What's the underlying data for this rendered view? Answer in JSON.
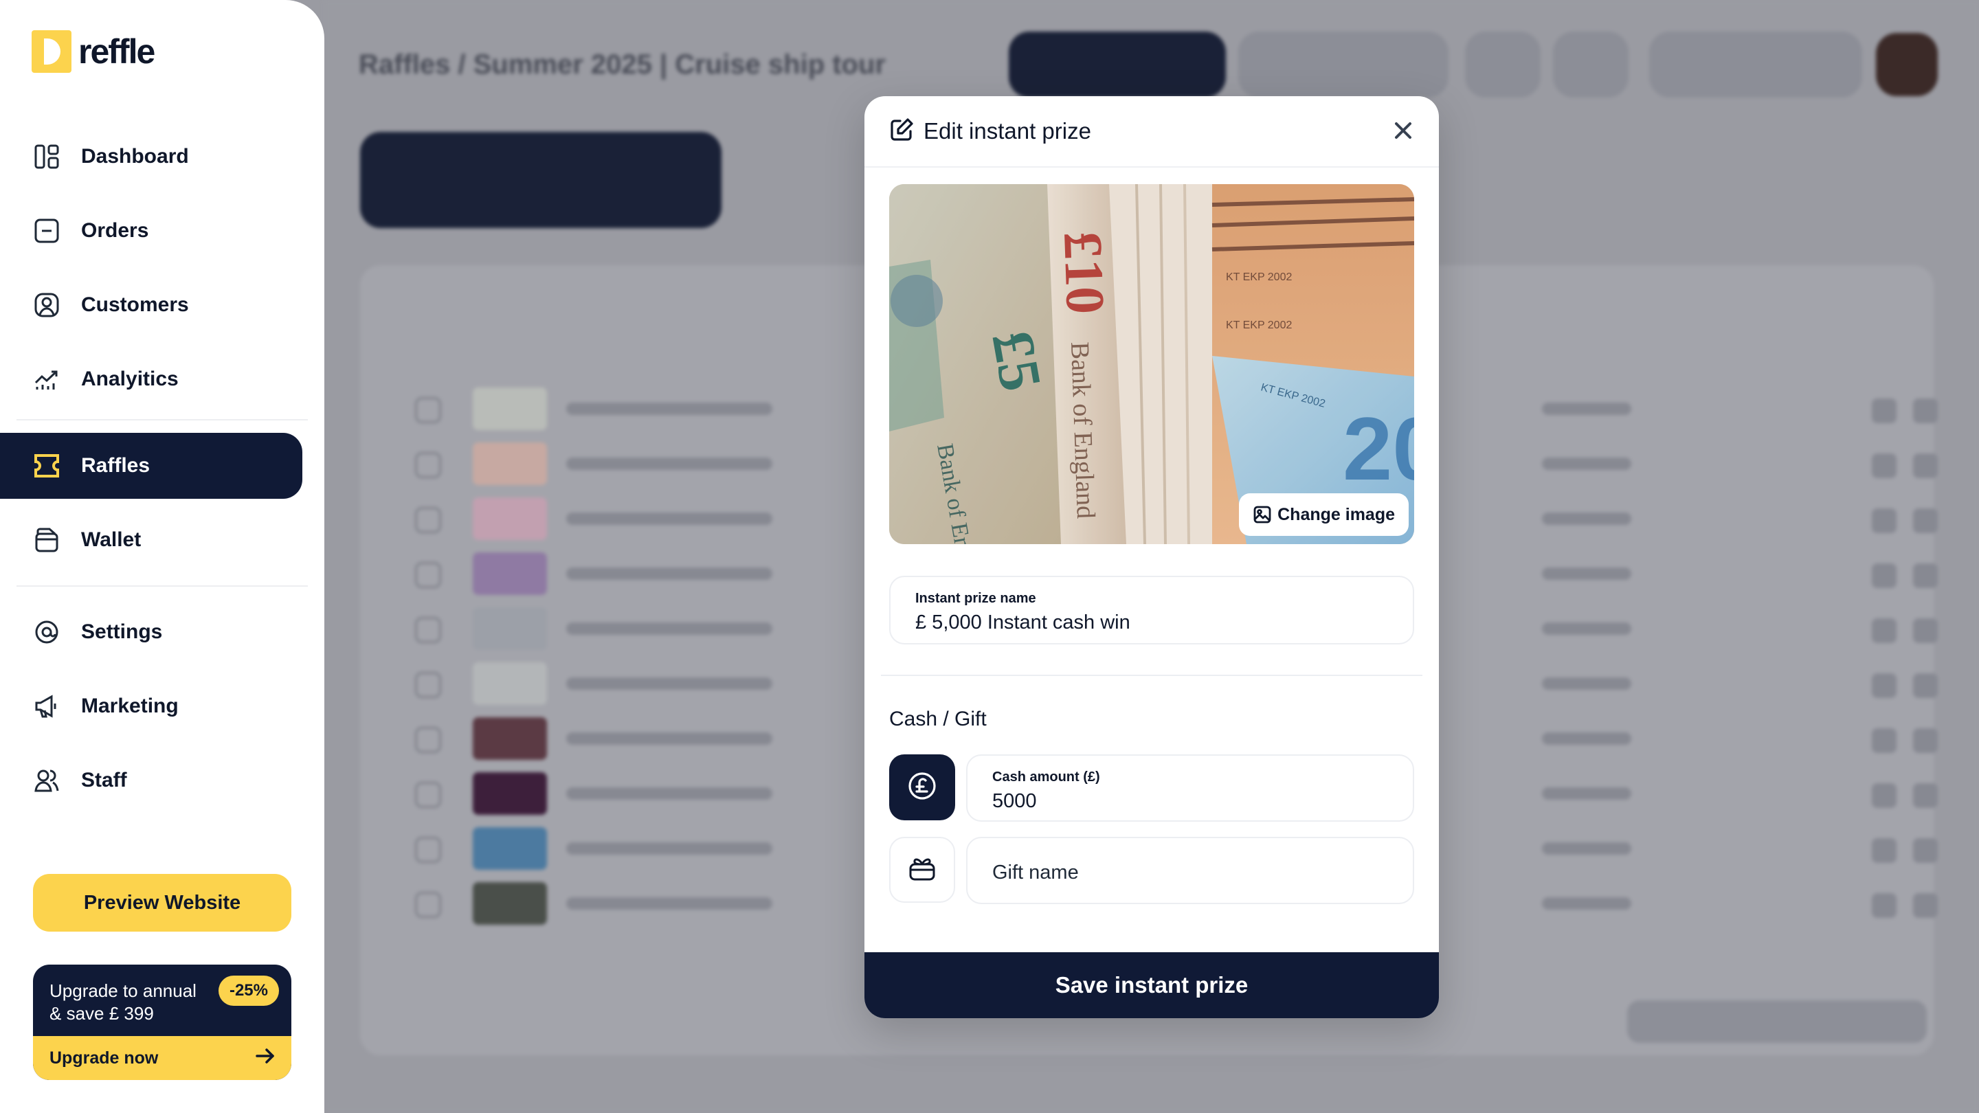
{
  "app": {
    "logo_text": "reffle"
  },
  "sidebar": {
    "items": [
      {
        "label": "Dashboard",
        "icon": "dashboard-icon"
      },
      {
        "label": "Orders",
        "icon": "orders-icon"
      },
      {
        "label": "Customers",
        "icon": "customers-icon"
      },
      {
        "label": "Analyitics",
        "icon": "analytics-icon"
      },
      {
        "label": "Raffles",
        "icon": "raffles-icon",
        "active": true
      },
      {
        "label": "Wallet",
        "icon": "wallet-icon"
      },
      {
        "label": "Settings",
        "icon": "settings-icon"
      },
      {
        "label": "Marketing",
        "icon": "megaphone-icon"
      },
      {
        "label": "Staff",
        "icon": "staff-icon"
      }
    ],
    "preview_button": "Preview Website",
    "upgrade": {
      "line1": "Upgrade to annual",
      "line2": "& save £ 399",
      "badge": "-25%",
      "cta": "Upgrade now"
    }
  },
  "background": {
    "title": "Raffles / Summer 2025 | Cruise ship tour"
  },
  "modal": {
    "title": "Edit instant prize",
    "change_image": "Change image",
    "prize_name": {
      "label": "Instant prize name",
      "value": "£ 5,000 Instant cash win"
    },
    "section_title": "Cash / Gift",
    "cash_amount": {
      "label": "Cash amount (£)",
      "value": "5000"
    },
    "gift_name": {
      "placeholder": "Gift name"
    },
    "save_label": "Save instant prize"
  },
  "colors": {
    "navy": "#101a36",
    "accent_yellow": "#fcd34d",
    "overlay_gray": "#9a9ba2"
  }
}
